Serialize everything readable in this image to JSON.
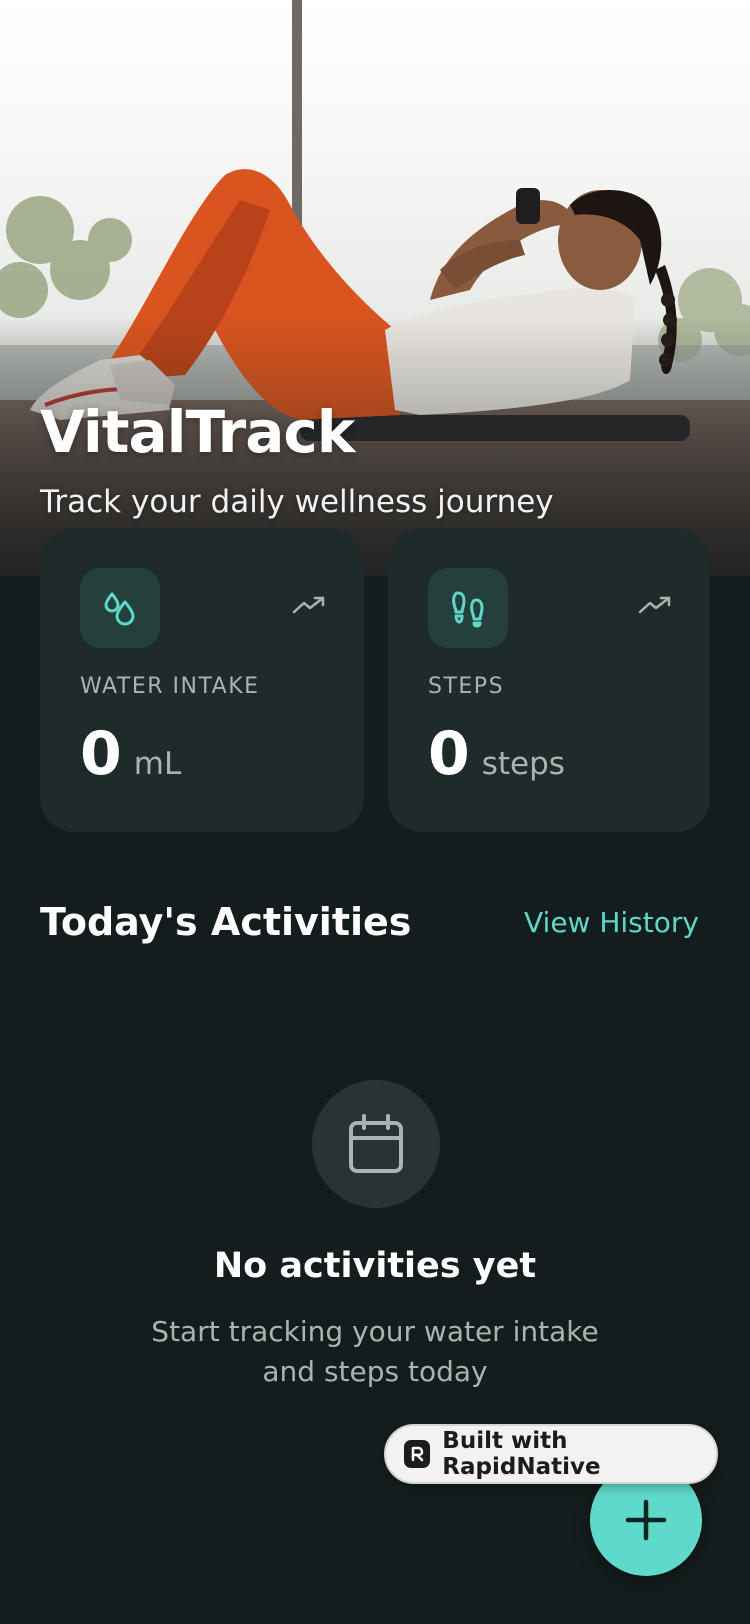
{
  "hero": {
    "app_title": "VitalTrack",
    "subtitle": "Track your daily wellness journey"
  },
  "stats": {
    "water": {
      "label": "WATER INTAKE",
      "value": "0",
      "unit": "mL",
      "icon": "water-drops-icon"
    },
    "steps": {
      "label": "STEPS",
      "value": "0",
      "unit": "steps",
      "icon": "footprints-icon"
    }
  },
  "activities": {
    "title": "Today's Activities",
    "view_history_label": "View History",
    "empty": {
      "icon": "calendar-icon",
      "title": "No activities yet",
      "description": "Start tracking your water intake and steps today"
    }
  },
  "badge": {
    "label": "Built with RapidNative"
  },
  "fab": {
    "icon": "plus-icon"
  },
  "colors": {
    "background": "#141d1d",
    "card": "#1f2a2a",
    "accent": "#5fd9ca",
    "muted_text": "#a9b3b1"
  }
}
